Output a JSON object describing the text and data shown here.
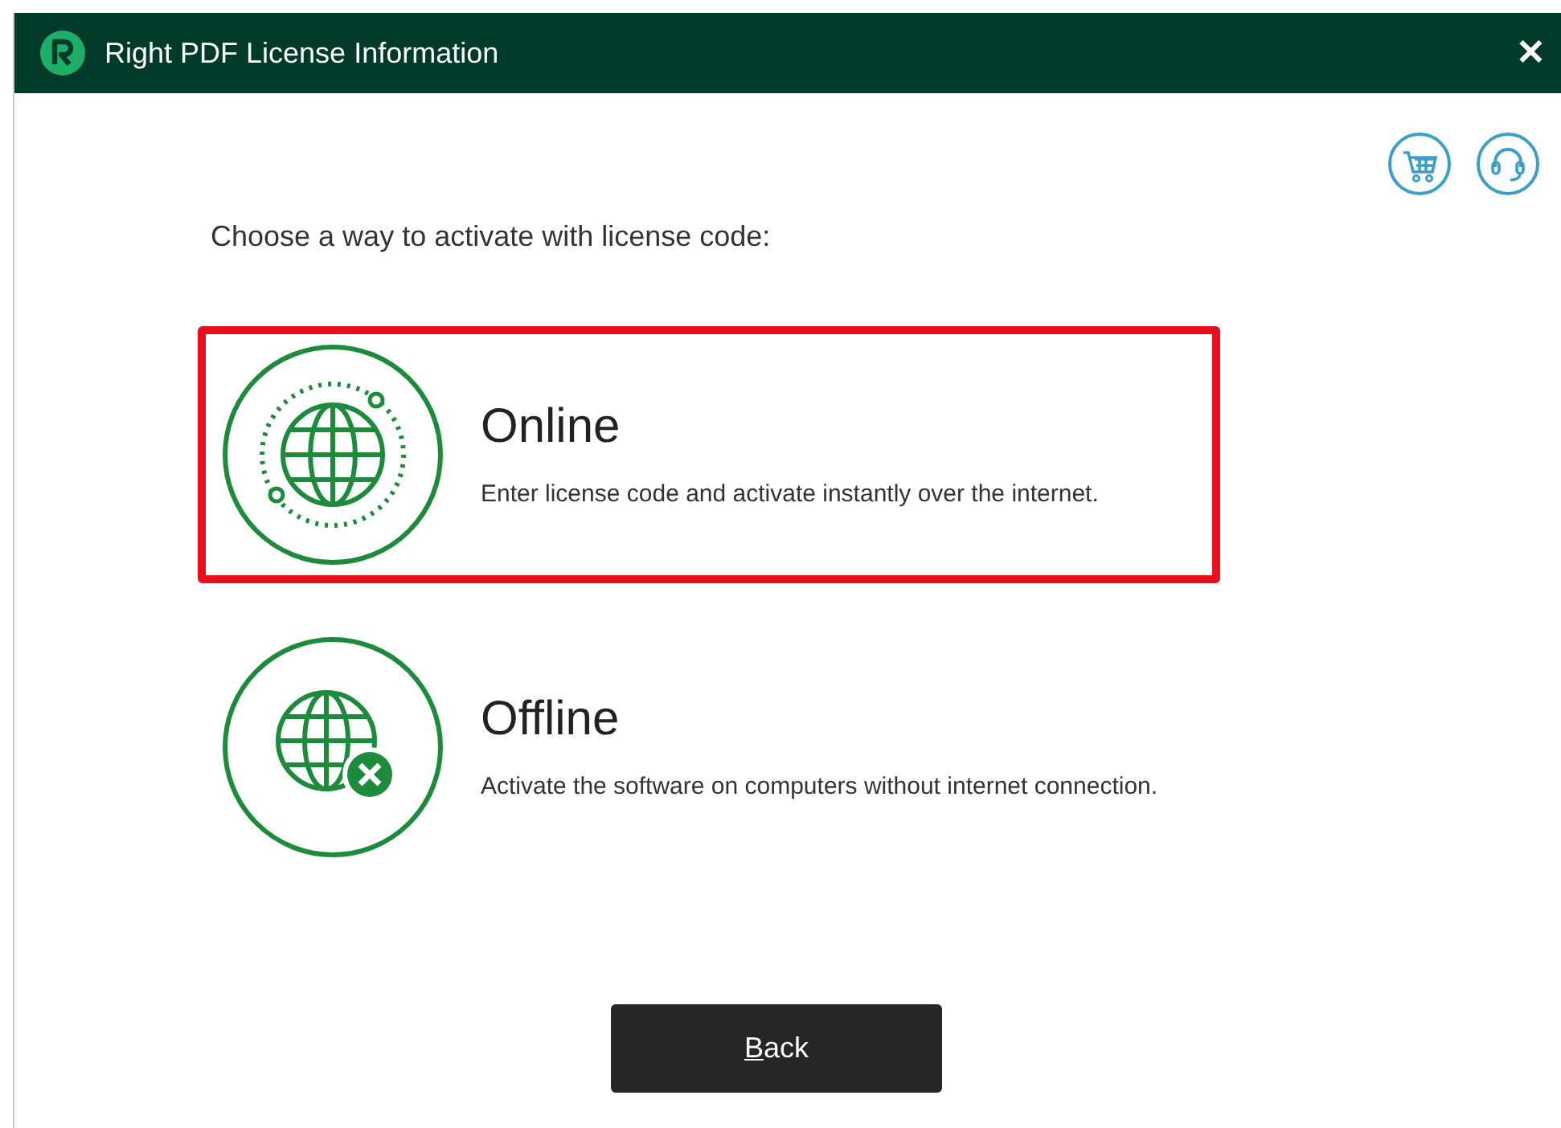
{
  "window": {
    "title": "Right PDF License Information",
    "close": "✕"
  },
  "prompt": "Choose a way to activate with license code:",
  "options": [
    {
      "kind": "online",
      "title": "Online",
      "description": "Enter license code and activate instantly over the internet.",
      "selected": true
    },
    {
      "kind": "offline",
      "title": "Offline",
      "description": "Activate the software on computers without internet connection.",
      "selected": false
    }
  ],
  "back_button": {
    "label": "Back",
    "access_key_underlined": true
  }
}
